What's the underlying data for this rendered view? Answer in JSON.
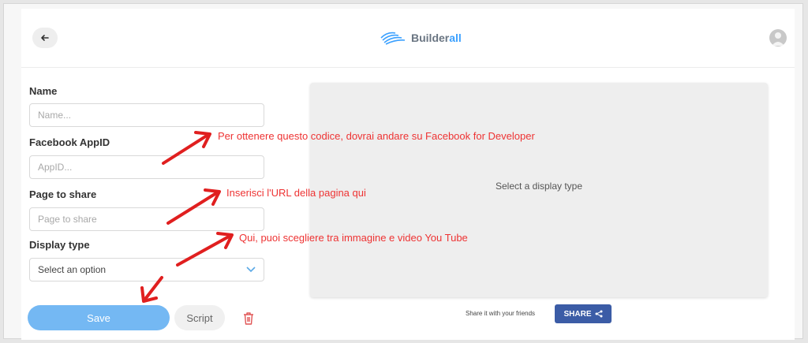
{
  "header": {
    "back_icon": "arrow-left-icon",
    "logo_prefix": "Builder",
    "logo_suffix": "all",
    "avatar_icon": "user-avatar-icon"
  },
  "form": {
    "name_label": "Name",
    "name_placeholder": "Name...",
    "appid_label": "Facebook AppID",
    "appid_placeholder": "AppID...",
    "page_label": "Page to share",
    "page_placeholder": "Page to share",
    "display_label": "Display type",
    "display_value": "Select an option"
  },
  "actions": {
    "save_label": "Save",
    "script_label": "Script",
    "delete_icon": "trash-icon"
  },
  "preview": {
    "placeholder": "Select a display type",
    "share_text": "Share it with your friends",
    "share_button": "SHARE"
  },
  "annotations": [
    "Per ottenere questo codice, dovrai andare su Facebook for Developer",
    "Inserisci l'URL della pagina qui",
    "Qui, puoi scegliere tra immagine e video You Tube"
  ],
  "colors": {
    "accent": "#3aa0ff",
    "save": "#74b8f3",
    "share": "#3b5ca6",
    "annotation": "#ee3333",
    "delete": "#e05555"
  }
}
